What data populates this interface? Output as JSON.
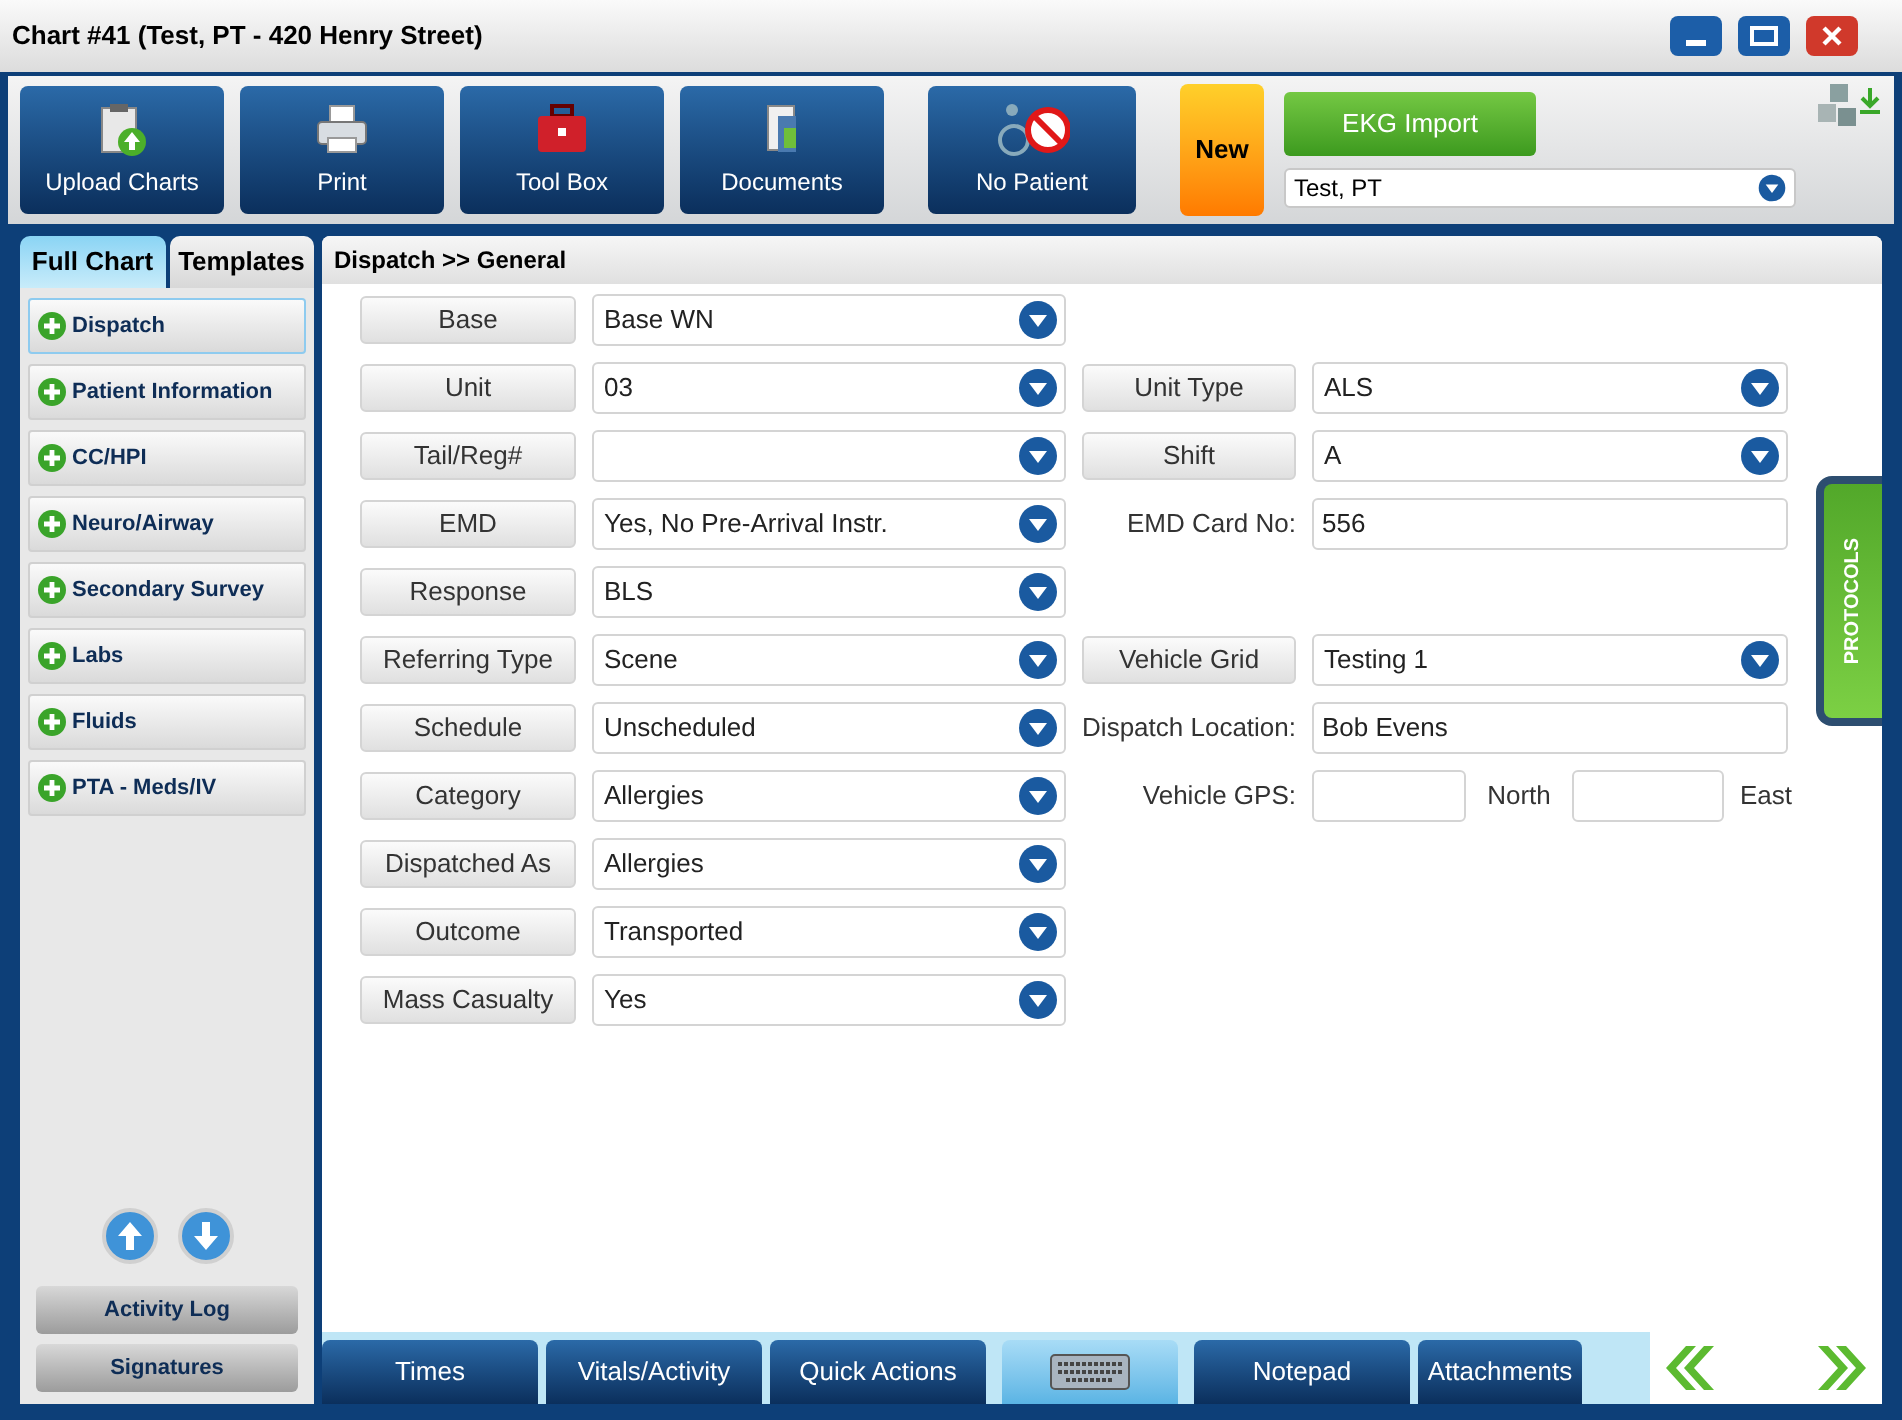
{
  "window": {
    "title": "Chart #41 (Test, PT - 420 Henry Street)"
  },
  "toolbar": [
    {
      "label": "Upload Charts",
      "kind": "upload"
    },
    {
      "label": "Print",
      "kind": "print"
    },
    {
      "label": "Tool Box",
      "kind": "toolbox"
    },
    {
      "label": "Documents",
      "kind": "documents"
    },
    {
      "label": "No Patient",
      "kind": "nopatient"
    }
  ],
  "new_button": "New",
  "ekg_button": "EKG Import",
  "patient_select": {
    "value": "Test, PT"
  },
  "side_tabs": [
    {
      "label": "Full Chart",
      "selected": true
    },
    {
      "label": "Templates",
      "selected": false
    }
  ],
  "sidebar": {
    "items": [
      {
        "label": "Dispatch",
        "selected": true
      },
      {
        "label": "Patient Information",
        "selected": false
      },
      {
        "label": "CC/HPI",
        "selected": false
      },
      {
        "label": "Neuro/Airway",
        "selected": false
      },
      {
        "label": "Secondary Survey",
        "selected": false
      },
      {
        "label": "Labs",
        "selected": false
      },
      {
        "label": "Fluids",
        "selected": false
      },
      {
        "label": "PTA - Meds/IV",
        "selected": false
      }
    ],
    "buttons": [
      "Activity Log",
      "Signatures"
    ]
  },
  "breadcrumb": "Dispatch >> General",
  "rows": [
    {
      "left": {
        "label": "Base",
        "value": "Base WN"
      }
    },
    {
      "left": {
        "label": "Unit",
        "value": "03"
      },
      "right": {
        "kind": "dropdown",
        "label": "Unit Type",
        "value": "ALS"
      }
    },
    {
      "left": {
        "label": "Tail/Reg#"
      },
      "right": {
        "kind": "dropdown",
        "label": "Shift",
        "value": "A"
      }
    },
    {
      "left": {
        "label": "EMD",
        "value": "Yes, No Pre-Arrival Instr."
      },
      "right": {
        "kind": "text",
        "label": "EMD Card No:",
        "value": "556"
      }
    },
    {
      "left": {
        "label": "Response",
        "value": "BLS"
      }
    },
    {
      "left": {
        "label": "Referring Type",
        "value": "Scene"
      },
      "right": {
        "kind": "dropdown",
        "label": "Vehicle Grid",
        "value": "Testing 1"
      }
    },
    {
      "left": {
        "label": "Schedule",
        "value": "Unscheduled"
      },
      "right": {
        "kind": "text",
        "label": "Dispatch Location:",
        "value": "Bob Evens"
      }
    },
    {
      "left": {
        "label": "Category",
        "value": "Allergies"
      },
      "right": {
        "kind": "gps",
        "label": "Vehicle GPS:",
        "north": "North",
        "east": "East"
      }
    },
    {
      "left": {
        "label": "Dispatched As",
        "value": "Allergies"
      }
    },
    {
      "left": {
        "label": "Outcome",
        "value": "Transported"
      }
    },
    {
      "left": {
        "label": "Mass Casualty",
        "value": "Yes"
      }
    }
  ],
  "protocols_tab": "PROTOCOLS",
  "bottom_tabs": [
    {
      "kind": "text",
      "label": "Times",
      "selected": false
    },
    {
      "kind": "text",
      "label": "Vitals/Activity",
      "selected": false
    },
    {
      "kind": "text",
      "label": "Quick Actions",
      "selected": false
    },
    {
      "kind": "keyboard",
      "selected": true
    },
    {
      "kind": "text",
      "label": "Notepad",
      "selected": false
    },
    {
      "kind": "text",
      "label": "Attachments",
      "selected": false
    }
  ]
}
